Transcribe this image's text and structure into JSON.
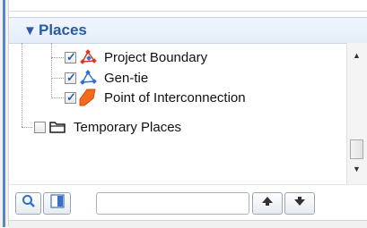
{
  "panel": {
    "title": "Places"
  },
  "tree": {
    "items": [
      {
        "label": "Project Boundary",
        "checked": true,
        "icon": "project-boundary-icon"
      },
      {
        "label": "Gen-tie",
        "checked": true,
        "icon": "gen-tie-icon"
      },
      {
        "label": "Point of Interconnection",
        "checked": true,
        "icon": "polygon-icon"
      },
      {
        "label": "Temporary Places",
        "checked": false,
        "icon": "folder-icon"
      }
    ]
  },
  "search": {
    "value": "",
    "placeholder": ""
  },
  "icons": {
    "search": "search-icon",
    "panel_toggle": "panel-toggle-icon",
    "up": "arrow-up-icon",
    "down": "arrow-down-icon"
  },
  "colors": {
    "header_text": "#2a5aa8",
    "polygon_fill": "#f26a1b",
    "accent_red": "#d83a1f",
    "accent_blue": "#2e6fd6"
  }
}
